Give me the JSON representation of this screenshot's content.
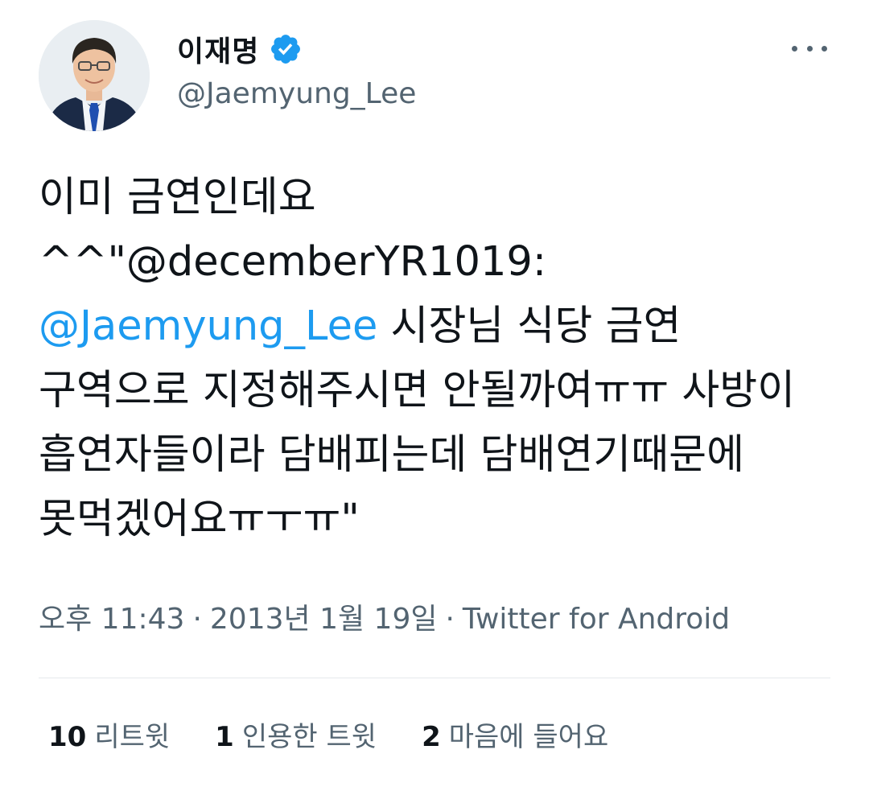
{
  "author": {
    "display_name": "이재명",
    "handle": "@Jaemyung_Lee",
    "verified": true,
    "avatar_icon": "avatar-photo",
    "verified_icon": "verified-badge-icon",
    "more_icon": "more-options-icon"
  },
  "tweet": {
    "line1": "이미 금연인데요",
    "line2": "^^\"@decemberYR1019:",
    "mention": "@Jaemyung_Lee",
    "after_mention": " 시장님 식당 금연 구역으로 지정해주시면 안될까여ㅠㅠ 사방이 흡연자들이라 담배피는데 담배연기때문에 못먹겠어요ㅠㅜㅠ\""
  },
  "meta": {
    "time": "오후 11:43",
    "separator": "·",
    "date": "2013년 1월 19일",
    "source": "Twitter for Android"
  },
  "stats": {
    "retweets_count": "10",
    "retweets_label": "리트윗",
    "quotes_count": "1",
    "quotes_label": "인용한 트윗",
    "likes_count": "2",
    "likes_label": "마음에 들어요"
  },
  "colors": {
    "accent": "#1d9bf0",
    "text": "#0f1419",
    "secondary": "#536471",
    "divider": "#e6e9ec"
  }
}
